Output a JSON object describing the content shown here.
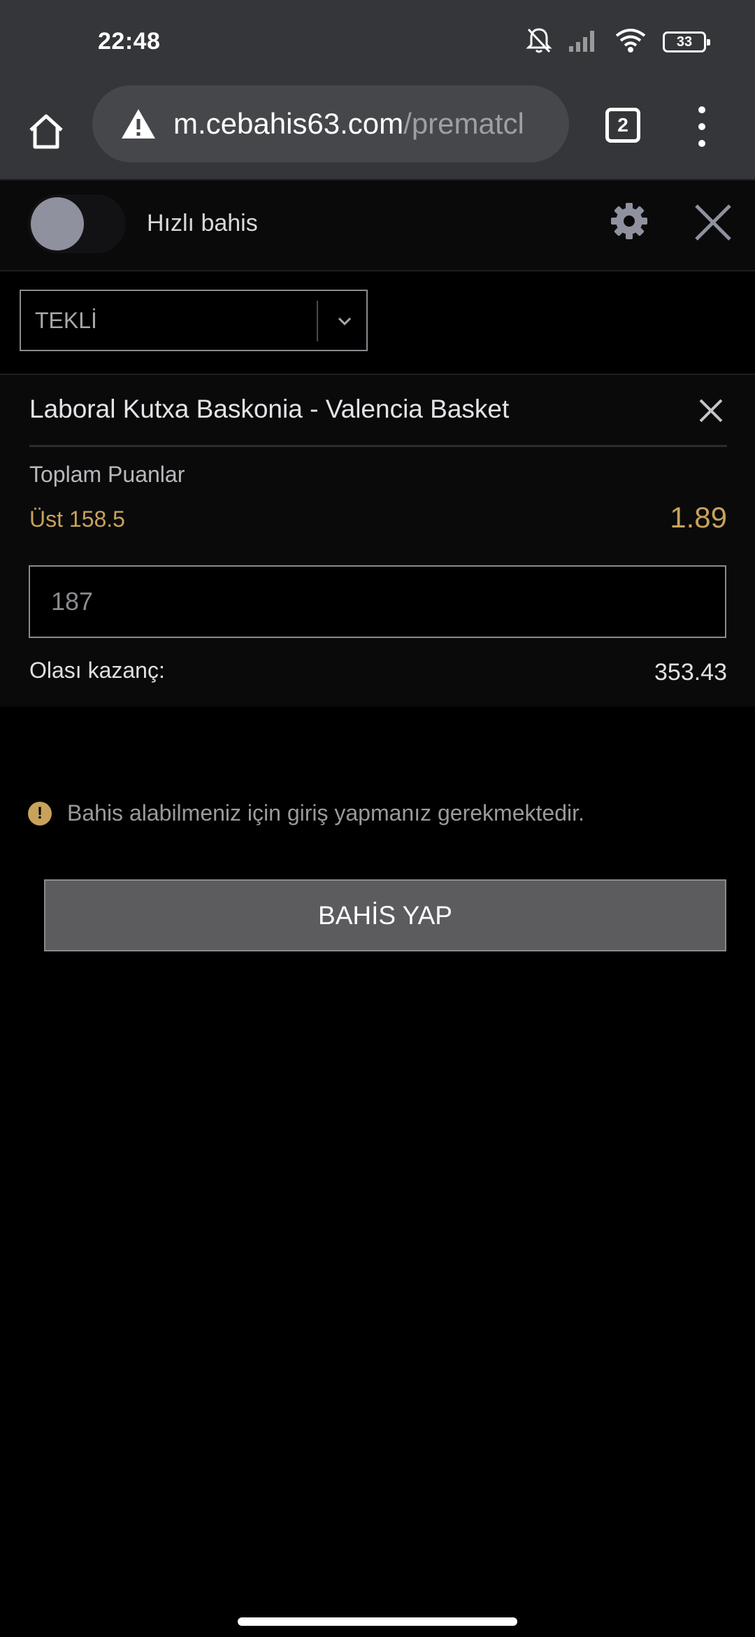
{
  "status_bar": {
    "time": "22:48",
    "battery": "33",
    "icons": [
      "bell-off-icon",
      "signal-icon",
      "wifi-icon",
      "battery-icon"
    ]
  },
  "browser": {
    "url_domain": "m.cebahis63.com",
    "url_path": "/prematcl",
    "tab_count": "2",
    "icons": [
      "home-icon",
      "warning-triangle-icon",
      "tabs-icon",
      "more-vert-icon"
    ]
  },
  "betslip": {
    "quick_bet_label": "Hızlı bahis",
    "quick_bet_enabled": false,
    "bet_type": "TEKLİ",
    "bet": {
      "match": "Laboral Kutxa Baskonia - Valencia Basket",
      "market": "Toplam Puanlar",
      "selection": "Üst 158.5",
      "odds": "1.89",
      "stake_placeholder": "187",
      "possible_win_label": "Olası kazanç:",
      "possible_win_value": "353.43"
    },
    "warning_text": "Bahis alabilmeniz için giriş yapmanız gerekmektedir.",
    "place_bet_label": "BAHİS YAP"
  },
  "colors": {
    "background": "#000000",
    "panel": "#0a0a0b",
    "accent_gold": "#c8a25b",
    "button_gray": "#5c5c5e",
    "browser_chrome": "#35363a"
  }
}
